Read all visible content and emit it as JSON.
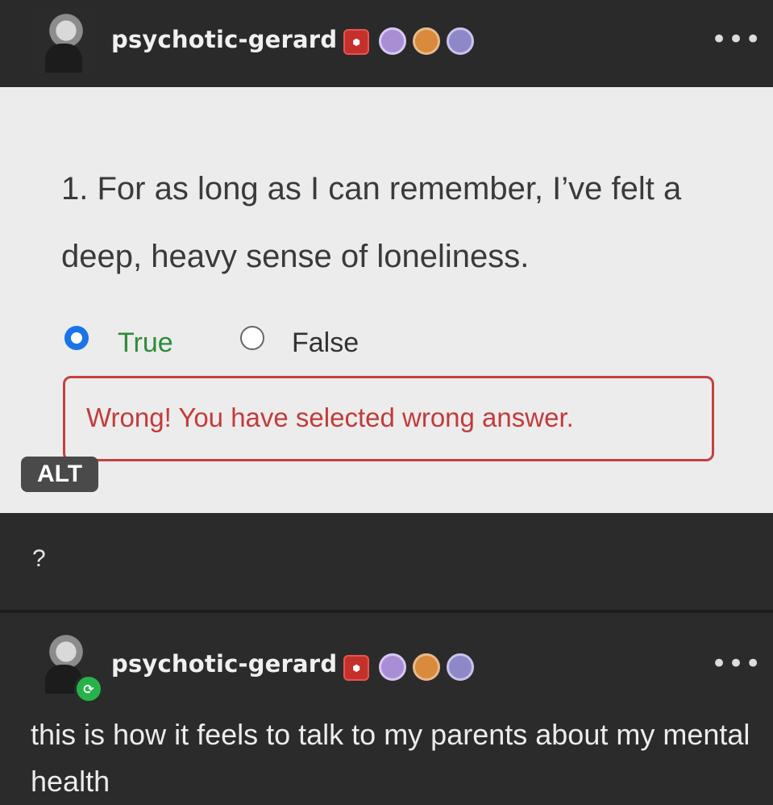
{
  "post": {
    "username": "psychotic-gerard",
    "more_menu": "•••",
    "badges": [
      "hexagon-badge-icon",
      "purple-badge-icon",
      "orange-badge-icon",
      "lilac-badge-icon"
    ]
  },
  "quiz": {
    "question": "1. For as long as I can remember, I’ve felt a deep, heavy sense of loneliness.",
    "options": [
      {
        "label": "True",
        "selected": true,
        "color": "#2e8b3a"
      },
      {
        "label": "False",
        "selected": false,
        "color": "#333333"
      }
    ],
    "error_message": "Wrong! You have selected wrong answer.",
    "alt_badge": "ALT"
  },
  "post_caption": "?",
  "reblog": {
    "username": "psychotic-gerard",
    "more_menu": "•••",
    "text": "this is how it feels to talk to my parents about my mental health"
  },
  "colors": {
    "dark_bg": "#2b2b2b",
    "quiz_bg": "#ececec",
    "error_red": "#c23b3b",
    "radio_blue": "#1a73e8",
    "reblog_green": "#27b24a"
  }
}
